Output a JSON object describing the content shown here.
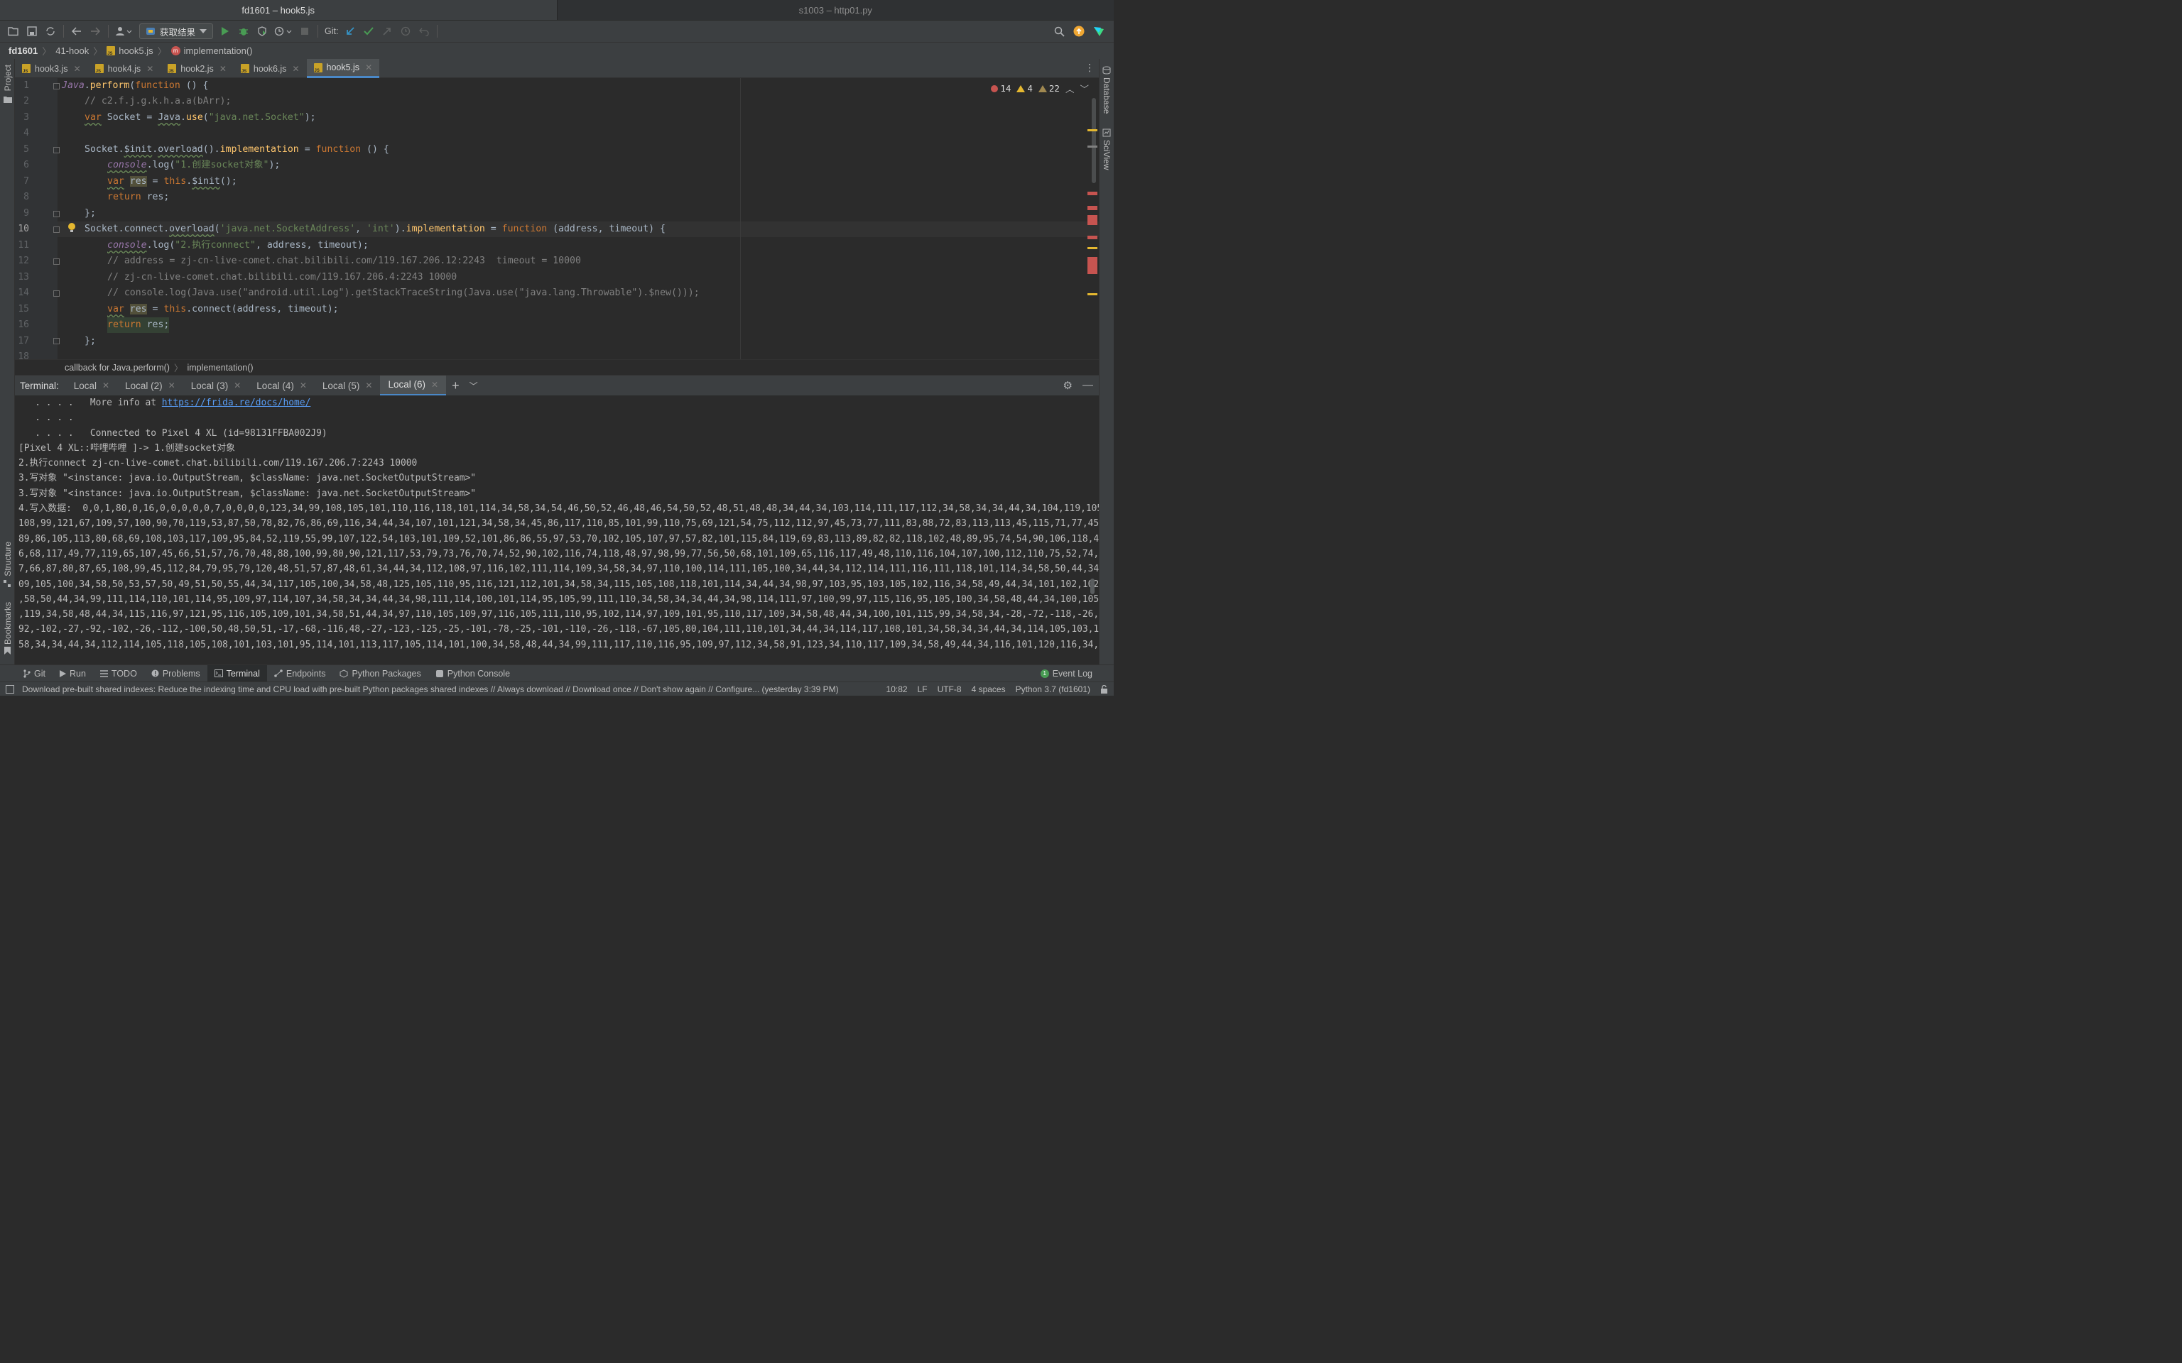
{
  "window_tabs": [
    {
      "label": "fd1601 – hook5.js",
      "active": true
    },
    {
      "label": "s1003 – http01.py",
      "active": false
    }
  ],
  "toolbar": {
    "run_config": "获取结果",
    "git_label": "Git:"
  },
  "navbar": {
    "crumbs": [
      "fd1601",
      "41-hook",
      "hook5.js",
      "implementation()"
    ]
  },
  "left_strip": {
    "project": "Project",
    "structure": "Structure",
    "bookmarks": "Bookmarks"
  },
  "right_strip": {
    "database": "Database",
    "sciview": "SciView"
  },
  "editor_tabs": [
    {
      "label": "hook3.js",
      "active": false
    },
    {
      "label": "hook4.js",
      "active": false
    },
    {
      "label": "hook2.js",
      "active": false
    },
    {
      "label": "hook6.js",
      "active": false
    },
    {
      "label": "hook5.js",
      "active": true
    }
  ],
  "inspections": {
    "errors": "14",
    "warnings": "4",
    "weak_warnings": "22"
  },
  "editor": {
    "line_numbers": [
      "1",
      "2",
      "3",
      "4",
      "5",
      "6",
      "7",
      "8",
      "9",
      "10",
      "11",
      "12",
      "13",
      "14",
      "15",
      "16",
      "17",
      "18"
    ],
    "current_line": "10",
    "lines": {
      "l1_a": "Java",
      "l1_b": ".",
      "l1_c": "perform",
      "l1_d": "(",
      "l1_e": "function",
      "l1_f": " () {",
      "l2": "// c2.f.j.g.k.h.a.a(bArr);",
      "l3_a": "var",
      "l3_b": " Socket = ",
      "l3_c": "Java",
      "l3_d": ".",
      "l3_e": "use",
      "l3_f": "(",
      "l3_g": "\"java.net.Socket\"",
      "l3_h": ");",
      "l5_a": "Socket.",
      "l5_b": "$init",
      "l5_c": ".",
      "l5_d": "overload",
      "l5_e": "().",
      "l5_f": "implementation",
      "l5_g": " = ",
      "l5_h": "function",
      "l5_i": " () {",
      "l6_a": "console",
      "l6_b": ".log(",
      "l6_c": "\"1.创建socket对象\"",
      "l6_d": ");",
      "l7_a": "var",
      "l7_b": " ",
      "l7_c": "res",
      "l7_d": " = ",
      "l7_e": "this",
      "l7_f": ".",
      "l7_g": "$init",
      "l7_h": "();",
      "l8_a": "return",
      "l8_b": " res;",
      "l9": "};",
      "l10_a": "Socket.",
      "l10_b": "connect",
      "l10_c": ".",
      "l10_d": "overload",
      "l10_e": "(",
      "l10_f": "'java.net.SocketAddress'",
      "l10_g": ", ",
      "l10_h": "'int'",
      "l10_i": ").",
      "l10_j": "implementation",
      "l10_k": " = ",
      "l10_l": "function",
      "l10_m": " (address, timeout) {",
      "l11_a": "console",
      "l11_b": ".log(",
      "l11_c": "\"2.执行connect\"",
      "l11_d": ", address, timeout);",
      "l12": "// address = zj-cn-live-comet.chat.bilibili.com/119.167.206.12:2243  timeout = 10000",
      "l13": "// zj-cn-live-comet.chat.bilibili.com/119.167.206.4:2243 10000",
      "l14": "// console.log(Java.use(\"android.util.Log\").getStackTraceString(Java.use(\"java.lang.Throwable\").$new()));",
      "l15_a": "var",
      "l15_b": " ",
      "l15_c": "res",
      "l15_d": " = ",
      "l15_e": "this",
      "l15_f": ".connect(address, timeout);",
      "l16_a": "return",
      "l16_b": " res;",
      "l17": "};"
    }
  },
  "editor_breadcrumbs": [
    "callback for Java.perform()",
    "implementation()"
  ],
  "terminal": {
    "label": "Terminal:",
    "tabs": [
      {
        "label": "Local",
        "active": false
      },
      {
        "label": "Local (2)",
        "active": false
      },
      {
        "label": "Local (3)",
        "active": false
      },
      {
        "label": "Local (4)",
        "active": false
      },
      {
        "label": "Local (5)",
        "active": false
      },
      {
        "label": "Local (6)",
        "active": true
      }
    ],
    "line1_prefix": "   . . . .   More info at ",
    "line1_link": "https://frida.re/docs/home/",
    "lines": [
      "   . . . .",
      "   . . . .   Connected to Pixel 4 XL (id=98131FFBA002J9)",
      "[Pixel 4 XL::哔哩哔哩 ]-> 1.创建socket对象",
      "2.执行connect zj-cn-live-comet.chat.bilibili.com/119.167.206.7:2243 10000",
      "3.写对象 \"<instance: java.io.OutputStream, $className: java.net.SocketOutputStream>\"",
      "3.写对象 \"<instance: java.io.OutputStream, $className: java.net.SocketOutputStream>\"",
      "4.写入数据:  0,0,1,80,0,16,0,0,0,0,0,7,0,0,0,0,123,34,99,108,105,101,110,116,118,101,114,34,58,34,54,46,50,52,46,48,46,54,50,52,48,51,48,48,34,44,34,103,114,111,117,112,34,58,34,34,44,34,104,119,105,100,34,58,3",
      "108,99,121,67,109,57,100,90,70,119,53,87,50,78,82,76,86,69,116,34,44,34,107,101,121,34,58,34,45,86,117,110,85,101,99,110,75,69,121,54,75,112,112,97,45,73,77,111,83,88,72,83,113,113,45,115,71,77,45,99,75,114,110",
      "89,86,105,113,80,68,69,108,103,117,109,95,84,52,119,55,99,107,122,54,103,101,109,52,101,86,86,55,97,53,70,102,105,107,97,57,82,101,115,84,119,69,83,113,89,82,82,118,102,48,89,95,74,54,90,106,118,49,90,51,114,6",
      "6,68,117,49,77,119,65,107,45,66,51,57,76,70,48,88,100,99,80,90,121,117,53,79,73,76,70,74,52,90,102,116,74,118,48,97,98,99,77,56,50,68,101,109,65,116,117,49,48,110,116,104,107,100,112,110,75,52,74,105,82,97,99,6",
      "7,66,87,80,87,65,108,99,45,112,84,79,95,79,120,48,51,57,87,48,61,34,44,34,112,108,97,116,102,111,114,109,34,58,34,97,110,100,114,111,105,100,34,44,34,112,114,111,116,111,118,101,114,34,58,50,44,34,114,111,111,1",
      "09,105,100,34,58,50,53,57,50,49,51,50,55,44,34,117,105,100,34,58,48,125,105,110,95,116,121,112,101,34,58,34,115,105,108,118,101,114,34,44,34,98,97,103,95,103,105,102,116,34,58,49,44,34,101,102,102,101,99,116,34",
      ",58,50,44,34,99,111,114,110,101,114,95,109,97,114,107,34,58,34,34,44,34,98,111,114,100,101,114,95,105,99,111,110,34,58,34,34,44,34,98,114,111,97,100,99,97,115,116,95,105,100,34,58,48,44,34,100,105,115,99,111,117",
      ",119,34,58,48,44,34,115,116,97,121,95,116,105,109,101,34,58,51,44,34,97,110,105,109,97,116,105,111,110,95,102,114,97,109,101,95,110,117,109,34,58,48,44,34,100,101,115,99,34,58,34,-28,-72,-118,-26,-117,-68,-27,-",
      "92,-102,-27,-92,-102,-26,-112,-100,50,48,50,51,-17,-68,-116,48,-27,-123,-125,-25,-101,-78,-25,-101,-110,-26,-118,-67,105,80,104,111,110,101,34,44,34,114,117,108,101,34,58,34,34,44,34,114,105,103,104,116,115,34,",
      "58,34,34,44,34,112,114,105,118,105,108,101,103,101,95,114,101,113,117,105,114,101,100,34,58,48,44,34,99,111,117,110,116,95,109,97,112,34,58,91,123,34,110,117,109,34,58,49,44,34,116,101,120,116,34,58,34,34,44,34"
    ]
  },
  "toolwindows": [
    "Git",
    "Run",
    "TODO",
    "Problems",
    "Terminal",
    "Endpoints",
    "Python Packages",
    "Python Console"
  ],
  "toolwindow_active": "Terminal",
  "event_log": "Event Log",
  "event_log_count": "1",
  "statusbar": {
    "message": "Download pre-built shared indexes: Reduce the indexing time and CPU load with pre-built Python packages shared indexes // Always download // Download once // Don't show again // Configure... (yesterday 3:39 PM)",
    "position": "10:82",
    "line_sep": "LF",
    "encoding": "UTF-8",
    "indent": "4 spaces",
    "interpreter": "Python 3.7 (fd1601)"
  },
  "colors": {
    "accent": "#4a88c7",
    "keyword": "#cc7832",
    "string": "#6a8759",
    "comment": "#808080",
    "error": "#c75450",
    "warning": "#e5b830"
  }
}
